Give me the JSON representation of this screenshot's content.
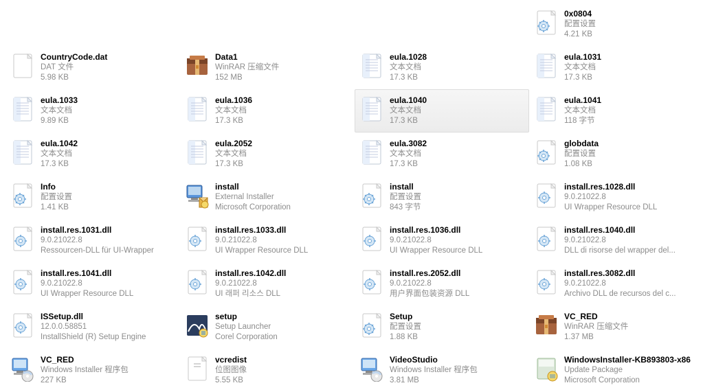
{
  "files": [
    {
      "empty": true
    },
    {
      "empty": true
    },
    {
      "empty": true
    },
    {
      "name": "0x0804",
      "type": "配置设置",
      "size": "4.21 KB",
      "icon": "config"
    },
    {
      "name": "CountryCode.dat",
      "type": "DAT 文件",
      "size": "5.98 KB",
      "icon": "blank"
    },
    {
      "name": "Data1",
      "type": "WinRAR 压缩文件",
      "size": "152 MB",
      "icon": "archive"
    },
    {
      "name": "eula.1028",
      "type": "文本文档",
      "size": "17.3 KB",
      "icon": "text"
    },
    {
      "name": "eula.1031",
      "type": "文本文档",
      "size": "17.3 KB",
      "icon": "text"
    },
    {
      "name": "eula.1033",
      "type": "文本文档",
      "size": "9.89 KB",
      "icon": "text"
    },
    {
      "name": "eula.1036",
      "type": "文本文档",
      "size": "17.3 KB",
      "icon": "text"
    },
    {
      "name": "eula.1040",
      "type": "文本文档",
      "size": "17.3 KB",
      "icon": "text",
      "selected": true
    },
    {
      "name": "eula.1041",
      "type": "文本文档",
      "size": "118 字节",
      "icon": "text"
    },
    {
      "name": "eula.1042",
      "type": "文本文档",
      "size": "17.3 KB",
      "icon": "text"
    },
    {
      "name": "eula.2052",
      "type": "文本文档",
      "size": "17.3 KB",
      "icon": "text"
    },
    {
      "name": "eula.3082",
      "type": "文本文档",
      "size": "17.3 KB",
      "icon": "text"
    },
    {
      "name": "globdata",
      "type": "配置设置",
      "size": "1.08 KB",
      "icon": "config"
    },
    {
      "name": "Info",
      "type": "配置设置",
      "size": "1.41 KB",
      "icon": "config"
    },
    {
      "name": "install",
      "type": "External Installer",
      "size": "Microsoft Corporation",
      "icon": "installer"
    },
    {
      "name": "install",
      "type": "配置设置",
      "size": "843 字节",
      "icon": "config"
    },
    {
      "name": "install.res.1028.dll",
      "type": "9.0.21022.8",
      "size": "UI Wrapper Resource DLL",
      "icon": "dll"
    },
    {
      "name": "install.res.1031.dll",
      "type": "9.0.21022.8",
      "size": "Ressourcen-DLL für UI-Wrapper",
      "icon": "dll"
    },
    {
      "name": "install.res.1033.dll",
      "type": "9.0.21022.8",
      "size": "UI Wrapper Resource DLL",
      "icon": "dll"
    },
    {
      "name": "install.res.1036.dll",
      "type": "9.0.21022.8",
      "size": "UI Wrapper Resource DLL",
      "icon": "dll"
    },
    {
      "name": "install.res.1040.dll",
      "type": "9.0.21022.8",
      "size": "DLL di risorse del wrapper del...",
      "icon": "dll"
    },
    {
      "name": "install.res.1041.dll",
      "type": "9.0.21022.8",
      "size": "UI Wrapper Resource DLL",
      "icon": "dll"
    },
    {
      "name": "install.res.1042.dll",
      "type": "9.0.21022.8",
      "size": "UI 래퍼 리소스 DLL",
      "icon": "dll"
    },
    {
      "name": "install.res.2052.dll",
      "type": "9.0.21022.8",
      "size": "用户界面包装资源 DLL",
      "icon": "dll"
    },
    {
      "name": "install.res.3082.dll",
      "type": "9.0.21022.8",
      "size": "Archivo DLL de recursos del c...",
      "icon": "dll"
    },
    {
      "name": "ISSetup.dll",
      "type": "12.0.0.58851",
      "size": "InstallShield (R) Setup Engine",
      "icon": "dll"
    },
    {
      "name": "setup",
      "type": "Setup Launcher",
      "size": "Corel Corporation",
      "icon": "setup"
    },
    {
      "name": "Setup",
      "type": "配置设置",
      "size": "1.88 KB",
      "icon": "config"
    },
    {
      "name": "VC_RED",
      "type": "WinRAR 压缩文件",
      "size": "1.37 MB",
      "icon": "archive"
    },
    {
      "name": "VC_RED",
      "type": "Windows Installer 程序包",
      "size": "227 KB",
      "icon": "msi"
    },
    {
      "name": "vcredist",
      "type": "位图图像",
      "size": "5.55 KB",
      "icon": "bitmap"
    },
    {
      "name": "VideoStudio",
      "type": "Windows Installer 程序包",
      "size": "3.81 MB",
      "icon": "msi"
    },
    {
      "name": "WindowsInstaller-KB893803-x86",
      "type": "Update Package",
      "size": "Microsoft Corporation",
      "icon": "update"
    }
  ]
}
